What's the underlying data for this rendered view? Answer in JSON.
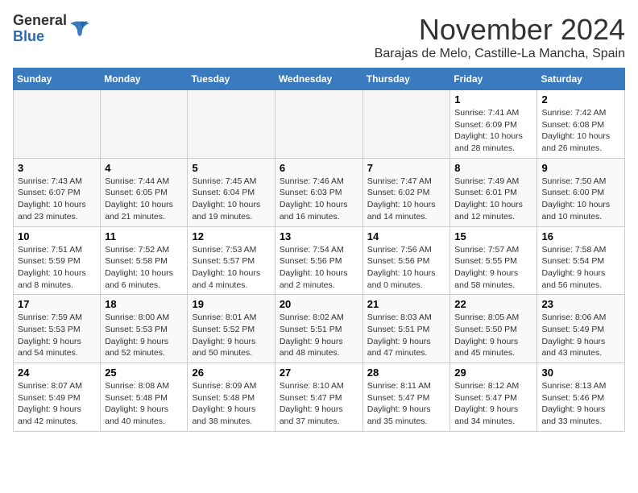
{
  "header": {
    "logo_general": "General",
    "logo_blue": "Blue",
    "month_title": "November 2024",
    "location": "Barajas de Melo, Castille-La Mancha, Spain"
  },
  "days_of_week": [
    "Sunday",
    "Monday",
    "Tuesday",
    "Wednesday",
    "Thursday",
    "Friday",
    "Saturday"
  ],
  "weeks": [
    [
      {
        "day": "",
        "detail": ""
      },
      {
        "day": "",
        "detail": ""
      },
      {
        "day": "",
        "detail": ""
      },
      {
        "day": "",
        "detail": ""
      },
      {
        "day": "",
        "detail": ""
      },
      {
        "day": "1",
        "detail": "Sunrise: 7:41 AM\nSunset: 6:09 PM\nDaylight: 10 hours and 28 minutes."
      },
      {
        "day": "2",
        "detail": "Sunrise: 7:42 AM\nSunset: 6:08 PM\nDaylight: 10 hours and 26 minutes."
      }
    ],
    [
      {
        "day": "3",
        "detail": "Sunrise: 7:43 AM\nSunset: 6:07 PM\nDaylight: 10 hours and 23 minutes."
      },
      {
        "day": "4",
        "detail": "Sunrise: 7:44 AM\nSunset: 6:05 PM\nDaylight: 10 hours and 21 minutes."
      },
      {
        "day": "5",
        "detail": "Sunrise: 7:45 AM\nSunset: 6:04 PM\nDaylight: 10 hours and 19 minutes."
      },
      {
        "day": "6",
        "detail": "Sunrise: 7:46 AM\nSunset: 6:03 PM\nDaylight: 10 hours and 16 minutes."
      },
      {
        "day": "7",
        "detail": "Sunrise: 7:47 AM\nSunset: 6:02 PM\nDaylight: 10 hours and 14 minutes."
      },
      {
        "day": "8",
        "detail": "Sunrise: 7:49 AM\nSunset: 6:01 PM\nDaylight: 10 hours and 12 minutes."
      },
      {
        "day": "9",
        "detail": "Sunrise: 7:50 AM\nSunset: 6:00 PM\nDaylight: 10 hours and 10 minutes."
      }
    ],
    [
      {
        "day": "10",
        "detail": "Sunrise: 7:51 AM\nSunset: 5:59 PM\nDaylight: 10 hours and 8 minutes."
      },
      {
        "day": "11",
        "detail": "Sunrise: 7:52 AM\nSunset: 5:58 PM\nDaylight: 10 hours and 6 minutes."
      },
      {
        "day": "12",
        "detail": "Sunrise: 7:53 AM\nSunset: 5:57 PM\nDaylight: 10 hours and 4 minutes."
      },
      {
        "day": "13",
        "detail": "Sunrise: 7:54 AM\nSunset: 5:56 PM\nDaylight: 10 hours and 2 minutes."
      },
      {
        "day": "14",
        "detail": "Sunrise: 7:56 AM\nSunset: 5:56 PM\nDaylight: 10 hours and 0 minutes."
      },
      {
        "day": "15",
        "detail": "Sunrise: 7:57 AM\nSunset: 5:55 PM\nDaylight: 9 hours and 58 minutes."
      },
      {
        "day": "16",
        "detail": "Sunrise: 7:58 AM\nSunset: 5:54 PM\nDaylight: 9 hours and 56 minutes."
      }
    ],
    [
      {
        "day": "17",
        "detail": "Sunrise: 7:59 AM\nSunset: 5:53 PM\nDaylight: 9 hours and 54 minutes."
      },
      {
        "day": "18",
        "detail": "Sunrise: 8:00 AM\nSunset: 5:53 PM\nDaylight: 9 hours and 52 minutes."
      },
      {
        "day": "19",
        "detail": "Sunrise: 8:01 AM\nSunset: 5:52 PM\nDaylight: 9 hours and 50 minutes."
      },
      {
        "day": "20",
        "detail": "Sunrise: 8:02 AM\nSunset: 5:51 PM\nDaylight: 9 hours and 48 minutes."
      },
      {
        "day": "21",
        "detail": "Sunrise: 8:03 AM\nSunset: 5:51 PM\nDaylight: 9 hours and 47 minutes."
      },
      {
        "day": "22",
        "detail": "Sunrise: 8:05 AM\nSunset: 5:50 PM\nDaylight: 9 hours and 45 minutes."
      },
      {
        "day": "23",
        "detail": "Sunrise: 8:06 AM\nSunset: 5:49 PM\nDaylight: 9 hours and 43 minutes."
      }
    ],
    [
      {
        "day": "24",
        "detail": "Sunrise: 8:07 AM\nSunset: 5:49 PM\nDaylight: 9 hours and 42 minutes."
      },
      {
        "day": "25",
        "detail": "Sunrise: 8:08 AM\nSunset: 5:48 PM\nDaylight: 9 hours and 40 minutes."
      },
      {
        "day": "26",
        "detail": "Sunrise: 8:09 AM\nSunset: 5:48 PM\nDaylight: 9 hours and 38 minutes."
      },
      {
        "day": "27",
        "detail": "Sunrise: 8:10 AM\nSunset: 5:47 PM\nDaylight: 9 hours and 37 minutes."
      },
      {
        "day": "28",
        "detail": "Sunrise: 8:11 AM\nSunset: 5:47 PM\nDaylight: 9 hours and 35 minutes."
      },
      {
        "day": "29",
        "detail": "Sunrise: 8:12 AM\nSunset: 5:47 PM\nDaylight: 9 hours and 34 minutes."
      },
      {
        "day": "30",
        "detail": "Sunrise: 8:13 AM\nSunset: 5:46 PM\nDaylight: 9 hours and 33 minutes."
      }
    ]
  ]
}
